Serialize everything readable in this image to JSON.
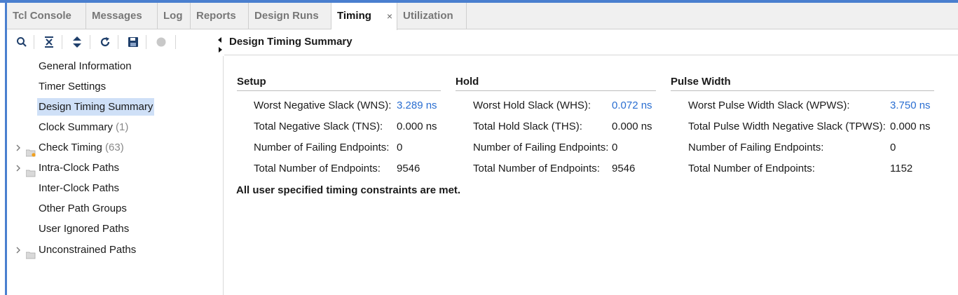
{
  "tabs": [
    {
      "label": "Tcl Console"
    },
    {
      "label": "Messages"
    },
    {
      "label": "Log"
    },
    {
      "label": "Reports"
    },
    {
      "label": "Design Runs"
    },
    {
      "label": "Timing",
      "active": true,
      "close": "×"
    },
    {
      "label": "Utilization"
    }
  ],
  "toolbar": {
    "icons": [
      "search-icon",
      "collapse-all-icon",
      "expand-all-icon",
      "refresh-icon",
      "save-icon",
      "stop-icon"
    ]
  },
  "tree": {
    "items": [
      {
        "label": "General Information",
        "count": ""
      },
      {
        "label": "Timer Settings",
        "count": ""
      },
      {
        "label": "Design Timing Summary",
        "count": "",
        "selected": true
      },
      {
        "label": "Clock Summary",
        "count": "(1)"
      },
      {
        "label": "Check Timing",
        "count": "(63)",
        "expandable": true,
        "folder": "folder-warning-icon"
      },
      {
        "label": "Intra-Clock Paths",
        "count": "",
        "expandable": true,
        "folder": "folder-icon"
      },
      {
        "label": "Inter-Clock Paths",
        "count": ""
      },
      {
        "label": "Other Path Groups",
        "count": ""
      },
      {
        "label": "User Ignored Paths",
        "count": ""
      },
      {
        "label": "Unconstrained Paths",
        "count": "",
        "expandable": true,
        "folder": "folder-icon"
      }
    ]
  },
  "pane": {
    "title": "Design Timing Summary"
  },
  "setup": {
    "heading": "Setup",
    "rows": [
      {
        "label": "Worst Negative Slack (WNS):",
        "value": "3.289 ns",
        "link": true
      },
      {
        "label": "Total Negative Slack (TNS):",
        "value": "0.000 ns"
      },
      {
        "label": "Number of Failing Endpoints:",
        "value": "0"
      },
      {
        "label": "Total Number of Endpoints:",
        "value": "9546"
      }
    ]
  },
  "hold": {
    "heading": "Hold",
    "rows": [
      {
        "label": "Worst Hold Slack (WHS):",
        "value": "0.072 ns",
        "link": true
      },
      {
        "label": "Total Hold Slack (THS):",
        "value": "0.000 ns"
      },
      {
        "label": "Number of Failing Endpoints:",
        "value": "0"
      },
      {
        "label": "Total Number of Endpoints:",
        "value": "9546"
      }
    ]
  },
  "pulse": {
    "heading": "Pulse Width",
    "rows": [
      {
        "label": "Worst Pulse Width Slack (WPWS):",
        "value": "3.750 ns",
        "link": true
      },
      {
        "label": "Total Pulse Width Negative Slack (TPWS):",
        "value": "0.000 ns"
      },
      {
        "label": "Number of Failing Endpoints:",
        "value": "0"
      },
      {
        "label": "Total Number of Endpoints:",
        "value": "1152"
      }
    ]
  },
  "note": "All user specified timing constraints are met.",
  "colors": {
    "accent": "#4a7fcf",
    "link": "#2a6ed1",
    "selection": "#cfe0f7"
  }
}
